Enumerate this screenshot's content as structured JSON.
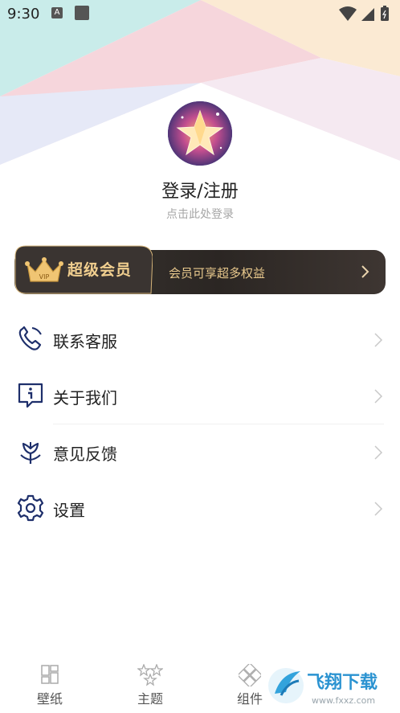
{
  "status_bar": {
    "time": "9:30",
    "notif_letter": "A"
  },
  "profile": {
    "title": "登录/注册",
    "subtitle": "点击此处登录"
  },
  "vip": {
    "title": "超级会员",
    "badge": "VIP",
    "description": "会员可享超多权益"
  },
  "menu": [
    {
      "label": "联系客服",
      "icon": "phone-icon"
    },
    {
      "label": "关于我们",
      "icon": "info-icon"
    },
    {
      "label": "意见反馈",
      "icon": "flower-icon"
    },
    {
      "label": "设置",
      "icon": "gear-icon"
    }
  ],
  "bottom_nav": [
    {
      "label": "壁纸",
      "icon": "grid-icon"
    },
    {
      "label": "主题",
      "icon": "stars-icon"
    },
    {
      "label": "组件",
      "icon": "widget-icon"
    }
  ],
  "watermark": {
    "text": "飞翔下载",
    "url": "www.fxxz.com"
  },
  "colors": {
    "accent_gold": "#f1cf8f",
    "banner_dark": "#2b2623",
    "muted": "#a6a6a6"
  }
}
